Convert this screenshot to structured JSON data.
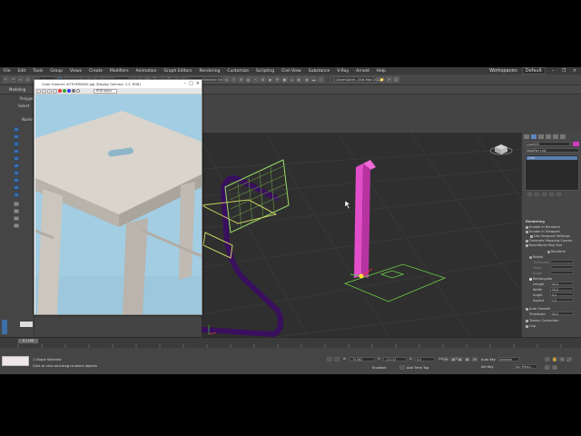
{
  "menu": [
    "File",
    "Edit",
    "Tools",
    "Group",
    "Views",
    "Create",
    "Modifiers",
    "Animation",
    "Graph Editors",
    "Rendering",
    "Customize",
    "Scripting",
    "Civil View",
    "Substance",
    "V-Ray",
    "Arnold",
    "Help"
  ],
  "menu_right": {
    "workspaces_label": "Workspaces:",
    "workspace_value": "Default"
  },
  "toolbar": {
    "filter": "All",
    "view": "View",
    "selection_set": "Create Selection Se",
    "path": "C:\\Users\\Andr...\\3ds Max 2021"
  },
  "ribbon": {
    "left_label": "Modeling",
    "poly_label": "Polygon"
  },
  "left_panel": {
    "select_label": "Select",
    "name_label": "Name"
  },
  "image_window": {
    "title": "Color channel: ACTIVEIMAGE.jpg (Display Gamma: 2.2, RGB)",
    "channel": "RGB Alpha"
  },
  "command_panel": {
    "object_name": "Line003",
    "modifier_list": "Modifier List",
    "stack_item": "Line",
    "rendering_header": "Rendering",
    "enable_render": "Enable In Renderer",
    "enable_viewport": "Enable In Viewport",
    "use_viewport": "Use Viewport Settings",
    "gen_mapping": "Generate Mapping Coords.",
    "real_world": "Real-World Map Size",
    "renderer_radio": "Renderer",
    "radial": "Radial",
    "thickness": "Thickness",
    "sides": "Sides",
    "angle": "Angle",
    "rectangular": "Rectangular",
    "length_label": "Length",
    "length_value": "20,0",
    "width_label": "Width",
    "width_value": "20,0",
    "angle2_label": "Angle",
    "angle2_value": "0,0",
    "aspect_label": "Aspect",
    "aspect_value": "1,0",
    "auto_smooth": "Auto Smooth",
    "threshold_label": "Threshold",
    "threshold_value": "40,0",
    "pinch_label": "Torsion Correction",
    "cap_label": "Cap"
  },
  "timeline": {
    "frame": "0 / 100"
  },
  "status": {
    "selected": "1 Shape Selected",
    "hint": "Click or click-and-drag to select objects",
    "x_label": "X:",
    "x_value": "-74,582",
    "y_label": "Y:",
    "y_value": "-112,42",
    "z_label": "Z:",
    "z_value": "0,0",
    "grid": "Grid = 10,0",
    "add_time_tag": "Add Time Tag",
    "enabled": "Enabled:",
    "autokey": "Auto Key",
    "setkey": "Set Key",
    "selected_dd": "Selected",
    "key_filters": "Key Filters..."
  }
}
